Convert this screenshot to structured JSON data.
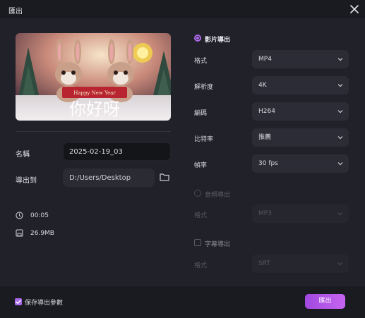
{
  "window": {
    "title": "匯出"
  },
  "preview": {
    "banner_text": "Happy New Year",
    "caption": "你好呀"
  },
  "file": {
    "name_label": "名稱",
    "name_value": "2025-02-19_03",
    "export_to_label": "導出到",
    "path_value": "D:/Users/Desktop",
    "duration": "00:05",
    "size": "26.9MB"
  },
  "video_export": {
    "label": "影片導出",
    "selected": true,
    "format_label": "格式",
    "format_value": "MP4",
    "resolution_label": "解析度",
    "resolution_value": "4K",
    "encoding_label": "編碼",
    "encoding_value": "H264",
    "bitrate_label": "比特率",
    "bitrate_value": "推薦",
    "framerate_label": "幀率",
    "framerate_value": "30  fps"
  },
  "audio_export": {
    "label": "音頻導出",
    "selected": false,
    "format_label": "格式",
    "format_value": "MP3"
  },
  "subtitle_export": {
    "label": "字幕導出",
    "checked": false,
    "format_label": "格式",
    "format_value": "SRT"
  },
  "footer": {
    "save_params_label": "保存導出參數",
    "save_params_checked": true,
    "export_button": "匯出"
  },
  "colors": {
    "accent": "#b06af0",
    "background": "#202129"
  }
}
